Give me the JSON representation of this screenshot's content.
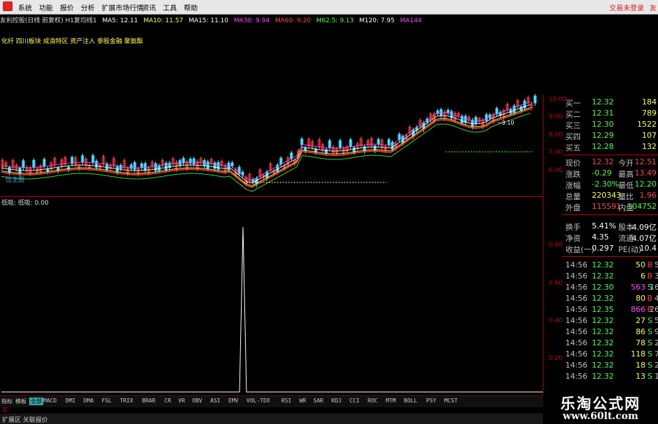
{
  "menu": {
    "items": [
      "系统",
      "功能",
      "报价",
      "分析",
      "扩展市场行情",
      "资讯",
      "工具",
      "帮助"
    ],
    "trade_label": "交易未登录",
    "right_char": "友"
  },
  "title": "友利控股(日线 前复权) H1复均线1",
  "ma_row": [
    {
      "text": "MA5: 12.11",
      "color": "#ffffff"
    },
    {
      "text": "MA10: 11.57",
      "color": "#ffff40"
    },
    {
      "text": "MA15: 11.10",
      "color": "#ffffff"
    },
    {
      "text": "MA30: 9.94",
      "color": "#ff40ff"
    },
    {
      "text": "MA60: 9.20",
      "color": "#ff4040"
    },
    {
      "text": "M62.5: 9.13",
      "color": "#40ff40"
    },
    {
      "text": "M120: 7.95",
      "color": "#ffffff"
    },
    {
      "text": "MA144",
      "color": "#ff40ff"
    }
  ],
  "concepts": "化纤 四川板块 成渝特区 资产注入 参股金融 聚氨酯",
  "indicator_label": "低吸: 低吸: 0.00",
  "main_chart_tag": "信主图",
  "price_axis": [
    "10.00",
    "9.00",
    "8.00",
    "7.00",
    "6.00"
  ],
  "ind_axis": [
    "0.80",
    "0.60",
    "0.40",
    "0.20"
  ],
  "chart_annot": "~9.10",
  "order_book": [
    {
      "label": "买一",
      "price": "12.32",
      "vol": "184"
    },
    {
      "label": "买二",
      "price": "12.31",
      "vol": "789"
    },
    {
      "label": "买三",
      "price": "12.30",
      "vol": "1522"
    },
    {
      "label": "买四",
      "price": "12.29",
      "vol": "107"
    },
    {
      "label": "买五",
      "price": "12.28",
      "vol": "132"
    }
  ],
  "quote": [
    {
      "k": "现价",
      "v": "12.32",
      "vc": "#ff4040",
      "k2": "今开",
      "v2": "12.51",
      "v2c": "#ff4040"
    },
    {
      "k": "涨跌",
      "v": "-0.29",
      "vc": "#40ff40",
      "k2": "最高",
      "v2": "13.49",
      "v2c": "#ff4040"
    },
    {
      "k": "涨幅",
      "v": "-2.30%",
      "vc": "#40ff40",
      "k2": "最低",
      "v2": "12.20",
      "v2c": "#40ff40"
    },
    {
      "k": "总量",
      "v": "220343",
      "vc": "#ffff40",
      "k2": "量比",
      "v2": "1.96",
      "v2c": "#ff4040"
    },
    {
      "k": "外盘",
      "v": "115591",
      "vc": "#ff4040",
      "k2": "内盘",
      "v2": "104752",
      "v2c": "#40ff40"
    }
  ],
  "fund": [
    {
      "k": "换手",
      "v": "5.41%",
      "k2": "股本",
      "v2": "4.09亿"
    },
    {
      "k": "净资",
      "v": "4.35",
      "k2": "流通",
      "v2": "4.07亿"
    },
    {
      "k": "收益(一)",
      "v": "0.297",
      "k2": "PE(动)",
      "v2": "10.4"
    }
  ],
  "ticks": [
    {
      "t": "14:56",
      "p": "12.32",
      "v": "50",
      "bs": "B",
      "c": "5"
    },
    {
      "t": "14:56",
      "p": "12.32",
      "v": "6",
      "bs": "B",
      "c": "3"
    },
    {
      "t": "14:56",
      "p": "12.30",
      "v": "563",
      "bs": "S",
      "c": "16"
    },
    {
      "t": "14:56",
      "p": "12.32",
      "v": "80",
      "bs": "B",
      "c": "4"
    },
    {
      "t": "14:56",
      "p": "12.35",
      "v": "866",
      "bs": "B",
      "c": "26"
    },
    {
      "t": "14:56",
      "p": "12.32",
      "v": "27",
      "bs": "S",
      "c": "5"
    },
    {
      "t": "14:56",
      "p": "12.32",
      "v": "86",
      "bs": "S",
      "c": "9"
    },
    {
      "t": "14:56",
      "p": "12.32",
      "v": "78",
      "bs": "S",
      "c": "2"
    },
    {
      "t": "14:56",
      "p": "12.32",
      "v": "118",
      "bs": "S",
      "c": "7"
    },
    {
      "t": "14:56",
      "p": "12.32",
      "v": "18",
      "bs": "S",
      "c": "2"
    },
    {
      "t": "14:56",
      "p": "12.32",
      "v": "13",
      "bs": "S",
      "c": "1"
    }
  ],
  "x_axis": [
    {
      "label": "2012年"
    },
    {
      "label": "8"
    },
    {
      "label": "9"
    },
    {
      "label": "10"
    },
    {
      "label": "11"
    },
    {
      "label": "12"
    },
    {
      "label": "2"
    },
    {
      "label": "3"
    },
    {
      "label": "4"
    },
    {
      "label": "5"
    },
    {
      "label": "6"
    }
  ],
  "tabs": [
    "指标",
    "模板",
    "全部",
    "MACD",
    "DMI",
    "DMA",
    "FSL",
    "TRIX",
    "BRAR",
    "CR",
    "VR",
    "OBV",
    "ASI",
    "EMV",
    "VOL-TDX",
    "RSI",
    "WR",
    "SAR",
    "KDJ",
    "CCI",
    "ROC",
    "MTM",
    "BOLL",
    "PSY",
    "MCST"
  ],
  "bottom_bar": "扩展区 关联报价",
  "watermark": {
    "title": "乐淘公式网",
    "url": "www.60lt.com"
  },
  "colors": {
    "up": "#ff4040",
    "down": "#40ff40",
    "bg": "#000000",
    "grid": "#b00000"
  }
}
